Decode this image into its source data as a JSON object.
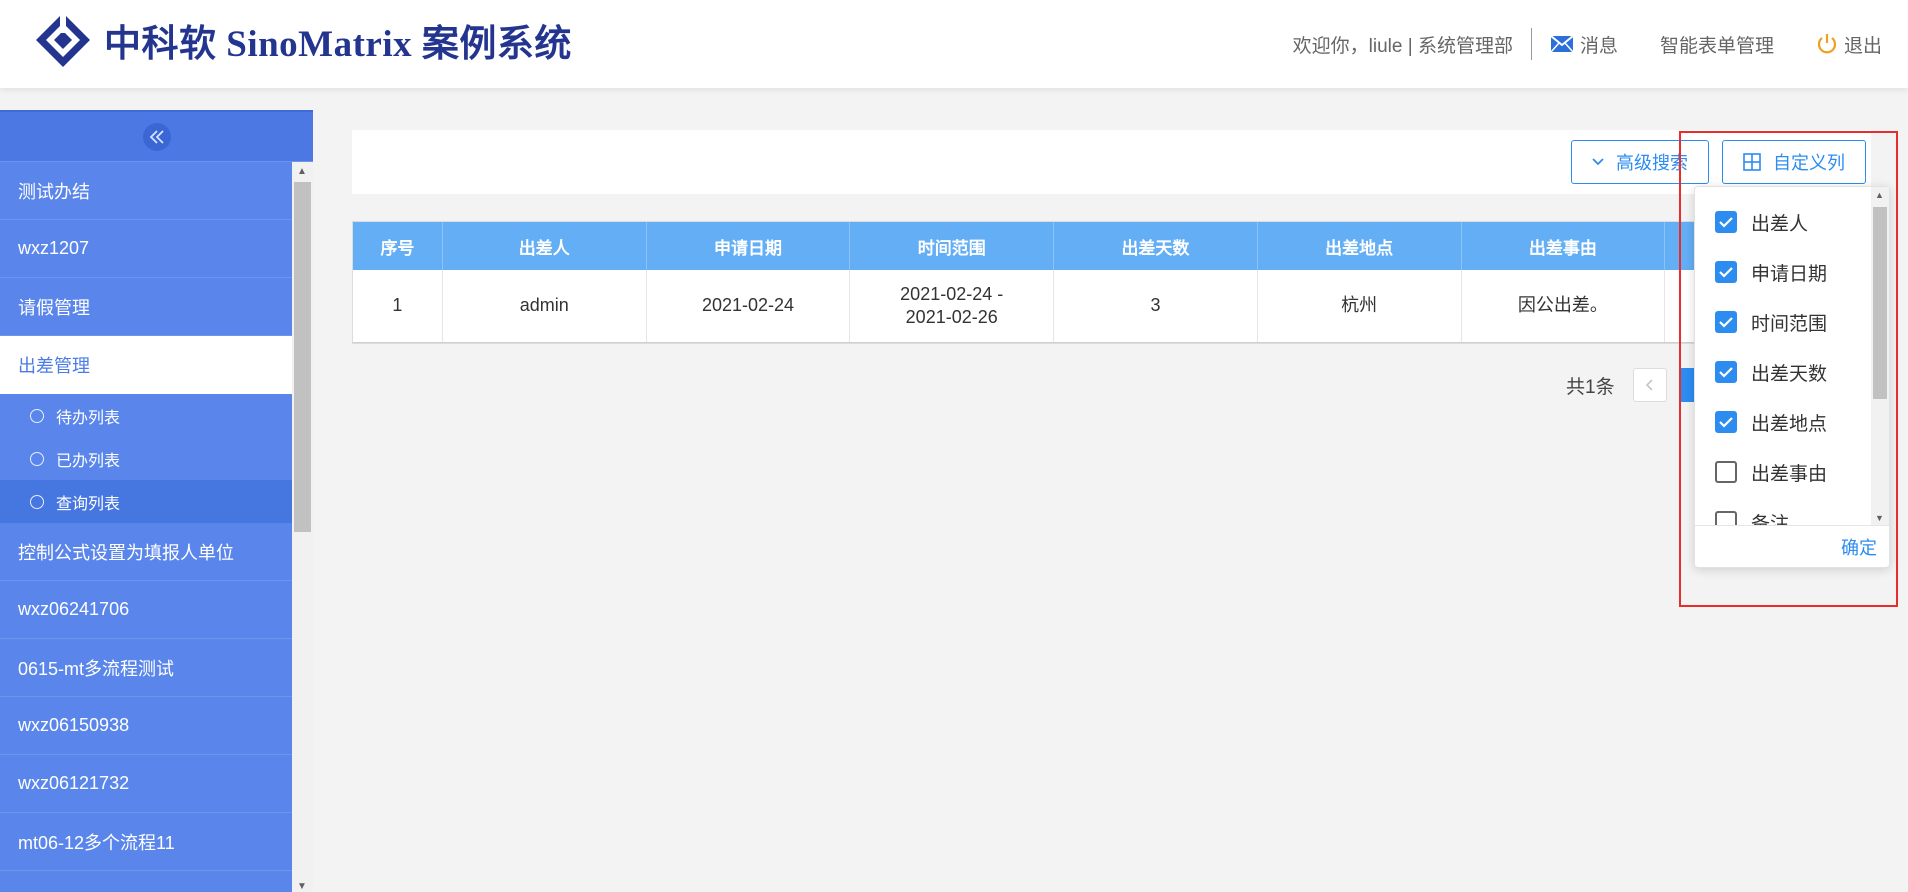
{
  "header": {
    "logo_text": "中科软 SinoMatrix 案例系统",
    "welcome": "欢迎你，liule | 系统管理部",
    "messages_label": "消息",
    "form_manage_label": "智能表单管理",
    "logout_label": "退出",
    "accent_color": "#23358f"
  },
  "sidebar": {
    "collapse_icon": "double-chevron-left-icon",
    "items": [
      {
        "label": "测试办结"
      },
      {
        "label": "wxz1207"
      },
      {
        "label": "请假管理"
      },
      {
        "label": "出差管理",
        "active": true
      },
      {
        "label": "控制公式设置为填报人单位"
      },
      {
        "label": "wxz06241706"
      },
      {
        "label": "0615-mt多流程测试"
      },
      {
        "label": "wxz06150938"
      },
      {
        "label": "wxz06121732"
      },
      {
        "label": "mt06-12多个流程11"
      }
    ],
    "sub_items": [
      {
        "label": "待办列表"
      },
      {
        "label": "已办列表"
      },
      {
        "label": "查询列表",
        "selected": true
      }
    ]
  },
  "toolbar": {
    "advanced_search_label": "高级搜索",
    "custom_columns_label": "自定义列"
  },
  "table": {
    "headers": [
      "序号",
      "出差人",
      "申请日期",
      "时间范围",
      "出差天数",
      "出差地点",
      "出差事由",
      ""
    ],
    "rows": [
      [
        "1",
        "admin",
        "2021-02-24",
        "2021-02-24 -\n2021-02-26",
        "3",
        "杭州",
        "因公出差。",
        ""
      ]
    ]
  },
  "pagination": {
    "total_label": "共1条",
    "prev_icon": "chevron-left-icon"
  },
  "column_picker": {
    "items": [
      {
        "label": "出差人",
        "checked": true
      },
      {
        "label": "申请日期",
        "checked": true
      },
      {
        "label": "时间范围",
        "checked": true
      },
      {
        "label": "出差天数",
        "checked": true
      },
      {
        "label": "出差地点",
        "checked": true
      },
      {
        "label": "出差事由",
        "checked": false
      },
      {
        "label": "备注",
        "checked": false
      }
    ],
    "confirm_label": "确定"
  },
  "colors": {
    "sidebar_bg": "#5a86eb",
    "table_header_bg": "#63aef4",
    "primary": "#2d8cf0",
    "highlight": "#e82d2d"
  }
}
